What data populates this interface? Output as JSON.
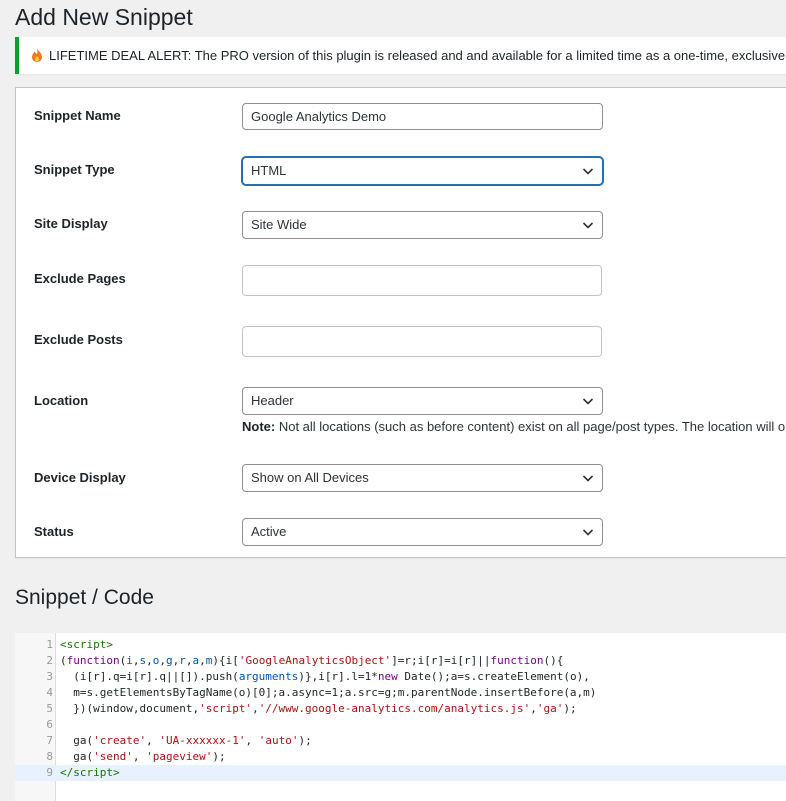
{
  "page": {
    "title": "Add New Snippet"
  },
  "notice": {
    "icon": "flame-icon",
    "text": "LIFETIME DEAL ALERT: The PRO version of this plugin is released and and available for a limited time as a one-time, exclusive lifetime deal. Want"
  },
  "form": {
    "snippet_name": {
      "label": "Snippet Name",
      "value": "Google Analytics Demo"
    },
    "snippet_type": {
      "label": "Snippet Type",
      "value": "HTML"
    },
    "site_display": {
      "label": "Site Display",
      "value": "Site Wide"
    },
    "exclude_pages": {
      "label": "Exclude Pages",
      "value": ""
    },
    "exclude_posts": {
      "label": "Exclude Posts",
      "value": ""
    },
    "location": {
      "label": "Location",
      "value": "Header",
      "note_label": "Note:",
      "note_text": " Not all locations (such as before content) exist on all page/post types. The location will only"
    },
    "device_display": {
      "label": "Device Display",
      "value": "Show on All Devices"
    },
    "status": {
      "label": "Status",
      "value": "Active"
    }
  },
  "code_section": {
    "title": "Snippet / Code",
    "line_numbers": [
      "1",
      "2",
      "3",
      "4",
      "5",
      "6",
      "7",
      "8",
      "9"
    ],
    "active_line": 9
  },
  "colors": {
    "accent": "#2271b1",
    "success": "#00a32a",
    "active_line": "#e8f2ff"
  }
}
